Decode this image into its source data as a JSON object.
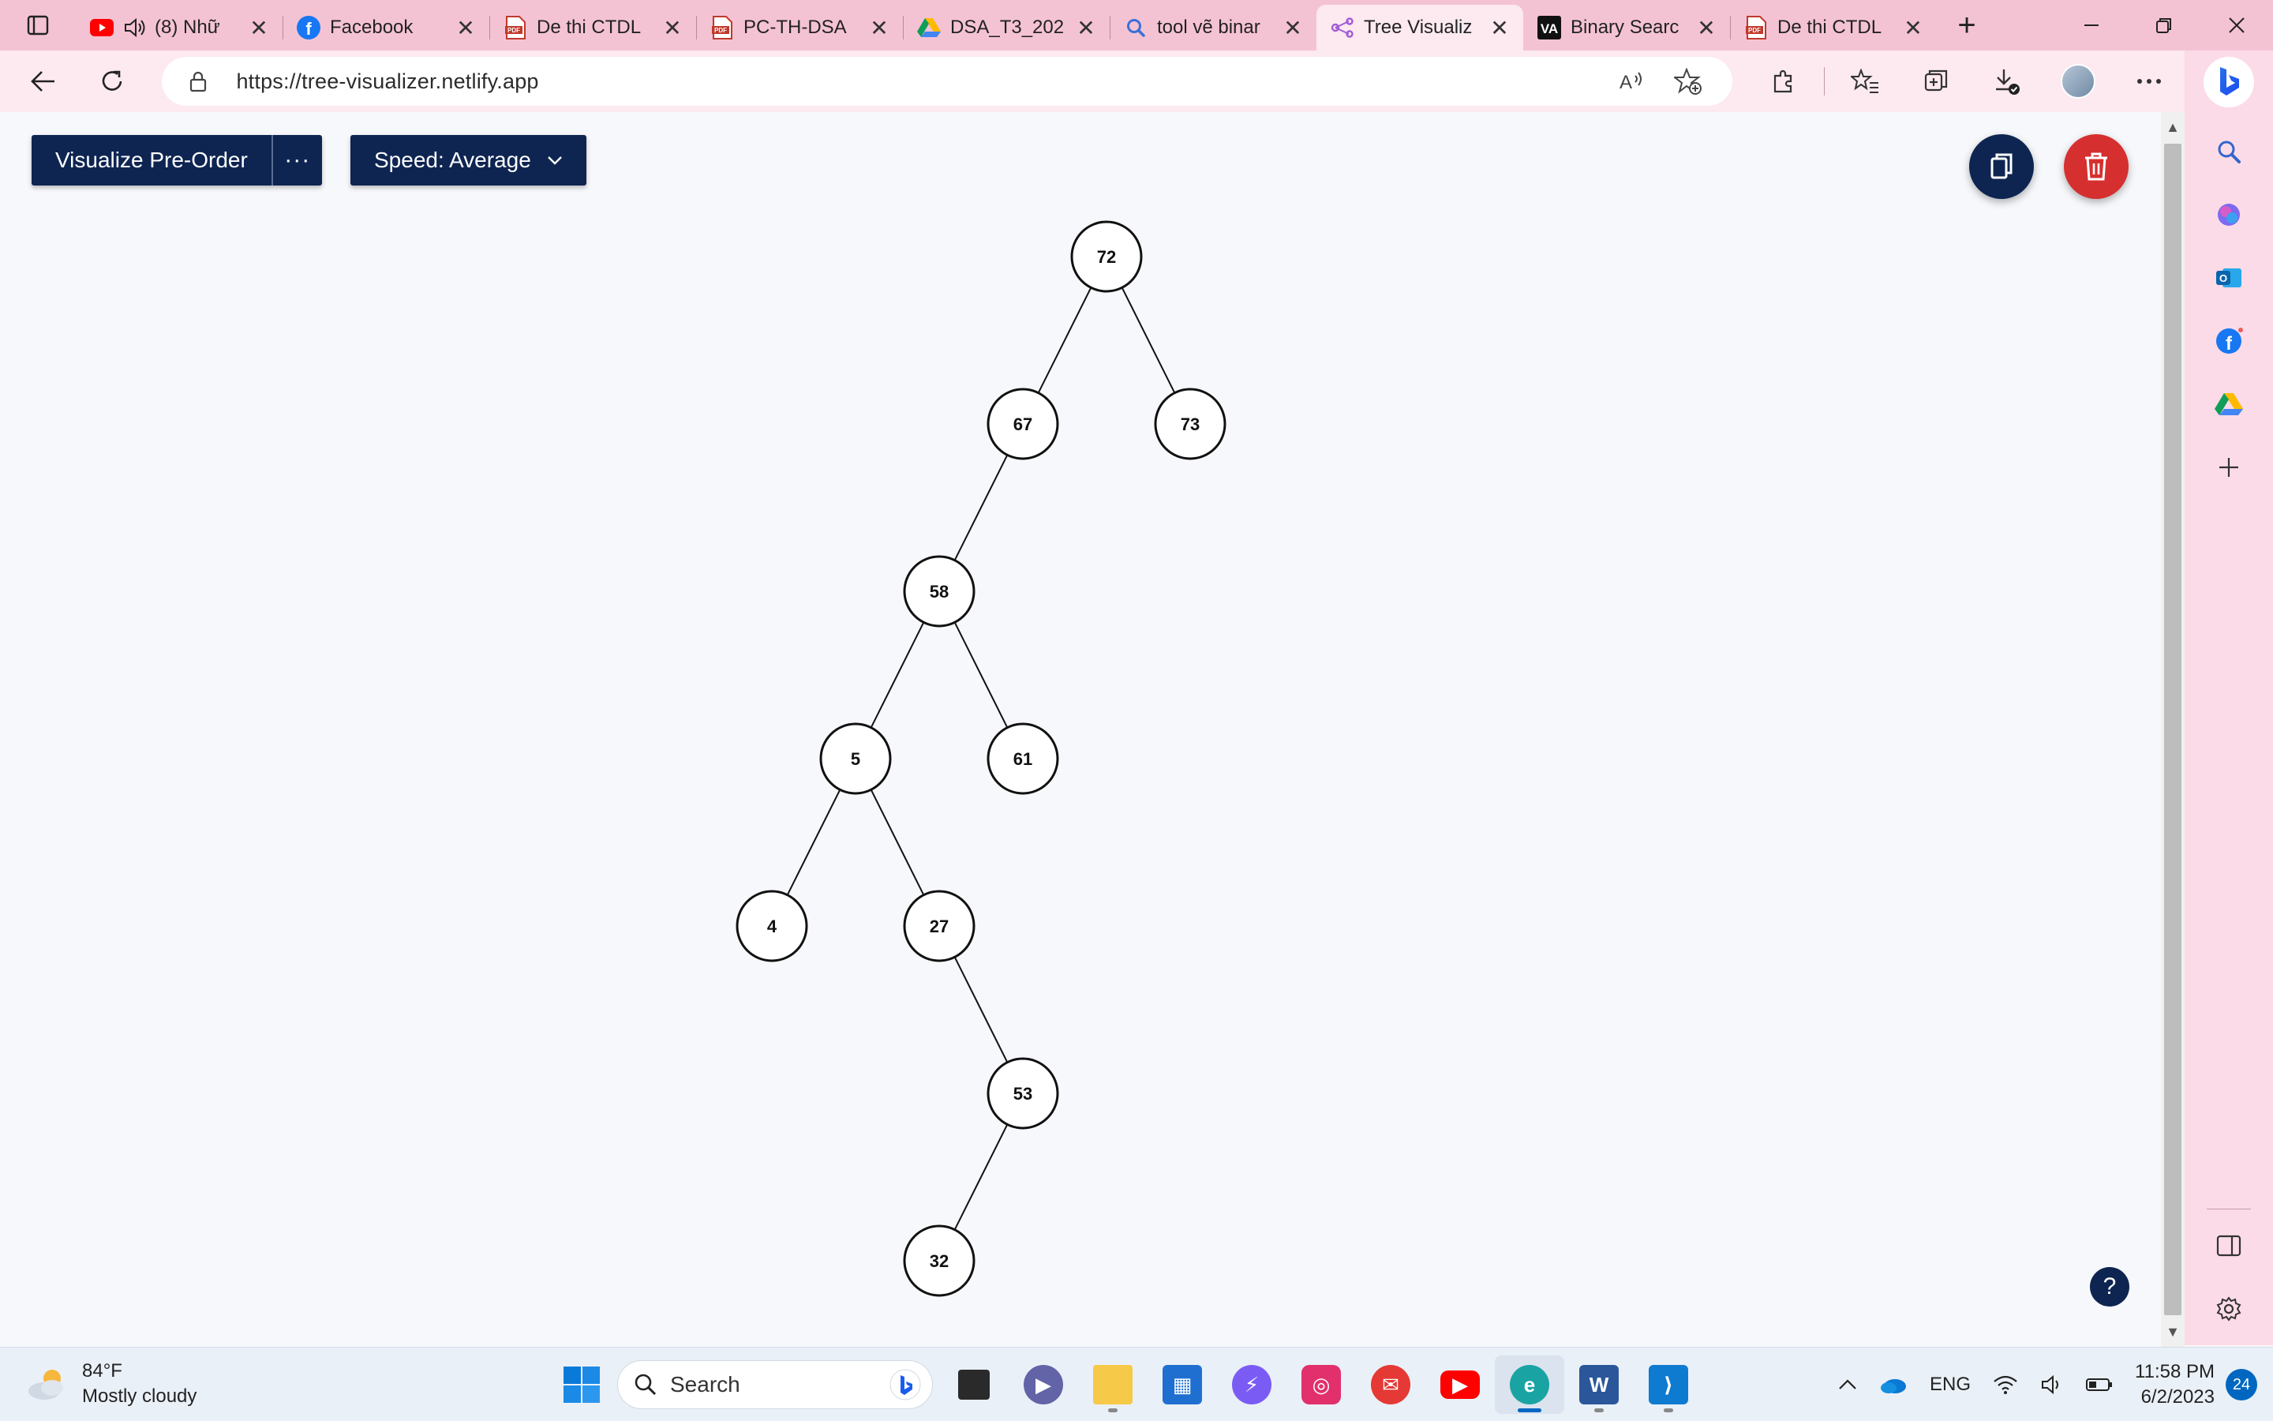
{
  "browser": {
    "tabs": [
      {
        "title": "(8) Nhữ",
        "icon": "youtube-icon",
        "muted_icon": "speaker-icon"
      },
      {
        "title": "Facebook",
        "icon": "facebook-icon"
      },
      {
        "title": "De thi CTDL",
        "icon": "pdf-icon"
      },
      {
        "title": "PC-TH-DSA",
        "icon": "pdf-icon"
      },
      {
        "title": "DSA_T3_202",
        "icon": "google-drive-icon"
      },
      {
        "title": "tool vẽ binar",
        "icon": "search-icon"
      },
      {
        "title": "Tree Visualiz",
        "icon": "tree-icon",
        "active": true
      },
      {
        "title": "Binary Searc",
        "icon": "va-icon"
      },
      {
        "title": "De thi CTDL",
        "icon": "pdf-icon"
      }
    ],
    "url": "https://tree-visualizer.netlify.app"
  },
  "app": {
    "visualize_label": "Visualize Pre-Order",
    "more_label": "···",
    "speed_label": "Speed: Average",
    "help_label": "?"
  },
  "tree": {
    "root": 72,
    "nodes": [
      {
        "id": "72",
        "value": "72",
        "parent": null,
        "side": null
      },
      {
        "id": "67",
        "value": "67",
        "parent": "72",
        "side": "left"
      },
      {
        "id": "73",
        "value": "73",
        "parent": "72",
        "side": "right"
      },
      {
        "id": "58",
        "value": "58",
        "parent": "67",
        "side": "left"
      },
      {
        "id": "5",
        "value": "5",
        "parent": "58",
        "side": "left"
      },
      {
        "id": "61",
        "value": "61",
        "parent": "58",
        "side": "right"
      },
      {
        "id": "4",
        "value": "4",
        "parent": "5",
        "side": "left"
      },
      {
        "id": "27",
        "value": "27",
        "parent": "5",
        "side": "right"
      },
      {
        "id": "53",
        "value": "53",
        "parent": "27",
        "side": "right"
      },
      {
        "id": "32",
        "value": "32",
        "parent": "53",
        "side": "left"
      }
    ]
  },
  "taskbar": {
    "weather_temp": "84°F",
    "weather_desc": "Mostly cloudy",
    "search_label": "Search",
    "language": "ENG",
    "time": "11:58 PM",
    "date": "6/2/2023",
    "notification_count": "24"
  },
  "colors": {
    "tab_strip": "#f4c3d3",
    "toolbar": "#fde9f0",
    "navy": "#0e2552",
    "danger": "#d62f2f"
  }
}
